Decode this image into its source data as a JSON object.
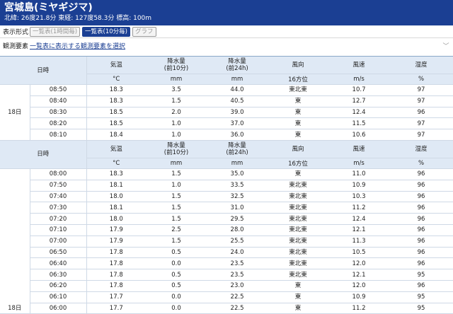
{
  "station": {
    "title": "宮城島(ミヤギジマ)",
    "coords": "北緯: 26度21.8分 東経: 127度58.3分 標高: 100m"
  },
  "display": {
    "label": "表示形式",
    "buttons": [
      "一覧表(1時間毎)",
      "一覧表(10分毎)",
      "グラフ"
    ],
    "active_index": 1
  },
  "elements": {
    "label": "観測要素",
    "select_text": "一覧表に表示する観測要素を選択"
  },
  "table": {
    "headers": {
      "datetime": "日時",
      "temp": "気温",
      "temp_unit": "°C",
      "precip10": "降水量\n(前10分)",
      "precip10_unit": "mm",
      "precip24": "降水量\n(前24h)",
      "precip24_unit": "mm",
      "wdir": "風向",
      "wdir_unit": "16方位",
      "wspd": "風速",
      "wspd_unit": "m/s",
      "hum": "湿度",
      "hum_unit": "%"
    },
    "block1": {
      "day": "18日",
      "rows": [
        [
          "08:50",
          "18.3",
          "3.5",
          "44.0",
          "東北東",
          "10.7",
          "97"
        ],
        [
          "08:40",
          "18.3",
          "1.5",
          "40.5",
          "東",
          "12.7",
          "97"
        ],
        [
          "08:30",
          "18.5",
          "2.0",
          "39.0",
          "東",
          "12.4",
          "96"
        ],
        [
          "08:20",
          "18.5",
          "1.0",
          "37.0",
          "東",
          "11.5",
          "97"
        ],
        [
          "08:10",
          "18.4",
          "1.0",
          "36.0",
          "東",
          "10.6",
          "97"
        ]
      ]
    },
    "block2": {
      "day": "18日",
      "rows": [
        [
          "08:00",
          "18.3",
          "1.5",
          "35.0",
          "東",
          "11.0",
          "96"
        ],
        [
          "07:50",
          "18.1",
          "1.0",
          "33.5",
          "東北東",
          "10.9",
          "96"
        ],
        [
          "07:40",
          "18.0",
          "1.5",
          "32.5",
          "東北東",
          "10.3",
          "96"
        ],
        [
          "07:30",
          "18.1",
          "1.5",
          "31.0",
          "東北東",
          "11.2",
          "96"
        ],
        [
          "07:20",
          "18.0",
          "1.5",
          "29.5",
          "東北東",
          "12.4",
          "96"
        ],
        [
          "07:10",
          "17.9",
          "2.5",
          "28.0",
          "東北東",
          "12.1",
          "96"
        ],
        [
          "07:00",
          "17.9",
          "1.5",
          "25.5",
          "東北東",
          "11.3",
          "96"
        ],
        [
          "06:50",
          "17.8",
          "0.5",
          "24.0",
          "東北東",
          "10.5",
          "96"
        ],
        [
          "06:40",
          "17.8",
          "0.0",
          "23.5",
          "東北東",
          "12.0",
          "96"
        ],
        [
          "06:30",
          "17.8",
          "0.5",
          "23.5",
          "東北東",
          "12.1",
          "95"
        ],
        [
          "06:20",
          "17.8",
          "0.5",
          "23.0",
          "東",
          "12.0",
          "96"
        ],
        [
          "06:10",
          "17.7",
          "0.0",
          "22.5",
          "東",
          "10.9",
          "95"
        ],
        [
          "06:00",
          "17.7",
          "0.0",
          "22.5",
          "東",
          "11.2",
          "95"
        ]
      ]
    }
  }
}
